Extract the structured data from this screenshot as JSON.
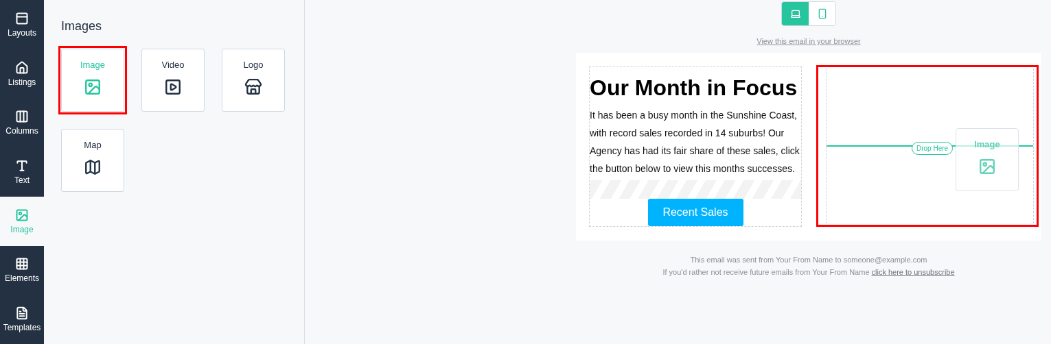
{
  "sidebar": {
    "items": [
      {
        "kind": "layouts",
        "label": "Layouts",
        "selected": false
      },
      {
        "kind": "listings",
        "label": "Listings",
        "selected": false
      },
      {
        "kind": "columns",
        "label": "Columns",
        "selected": false
      },
      {
        "kind": "text",
        "label": "Text",
        "selected": false
      },
      {
        "kind": "image",
        "label": "Image",
        "selected": true
      },
      {
        "kind": "elements",
        "label": "Elements",
        "selected": false
      },
      {
        "kind": "templates",
        "label": "Templates",
        "selected": false
      }
    ]
  },
  "panel": {
    "title": "Images",
    "tiles": [
      {
        "kind": "image",
        "label": "Image",
        "selected": true
      },
      {
        "kind": "video",
        "label": "Video",
        "selected": false
      },
      {
        "kind": "logo",
        "label": "Logo",
        "selected": false
      },
      {
        "kind": "map",
        "label": "Map",
        "selected": false
      }
    ]
  },
  "preview": {
    "devices": [
      {
        "kind": "desktop",
        "selected": true
      },
      {
        "kind": "mobile",
        "selected": false
      }
    ],
    "browser_link": "View this email in your browser",
    "heading": "Our Month in Focus",
    "body": "It has been a busy month in the Sunshine Coast, with record sales recorded in 14 suburbs! Our Agency has had its fair share of these sales, click the button below to view this months successes.",
    "button": "Recent Sales",
    "drop_zone": {
      "highlighted": true,
      "label": "Drop Here",
      "dragged_tile": {
        "kind": "image",
        "label": "Image"
      }
    },
    "footer": {
      "sent_line": "This email was sent from Your From Name to someone@example.com",
      "unsubscribe_text": "If you'd rather not receive future emails from Your From Name",
      "unsubscribe_link": "click here to unsubscribe"
    }
  }
}
